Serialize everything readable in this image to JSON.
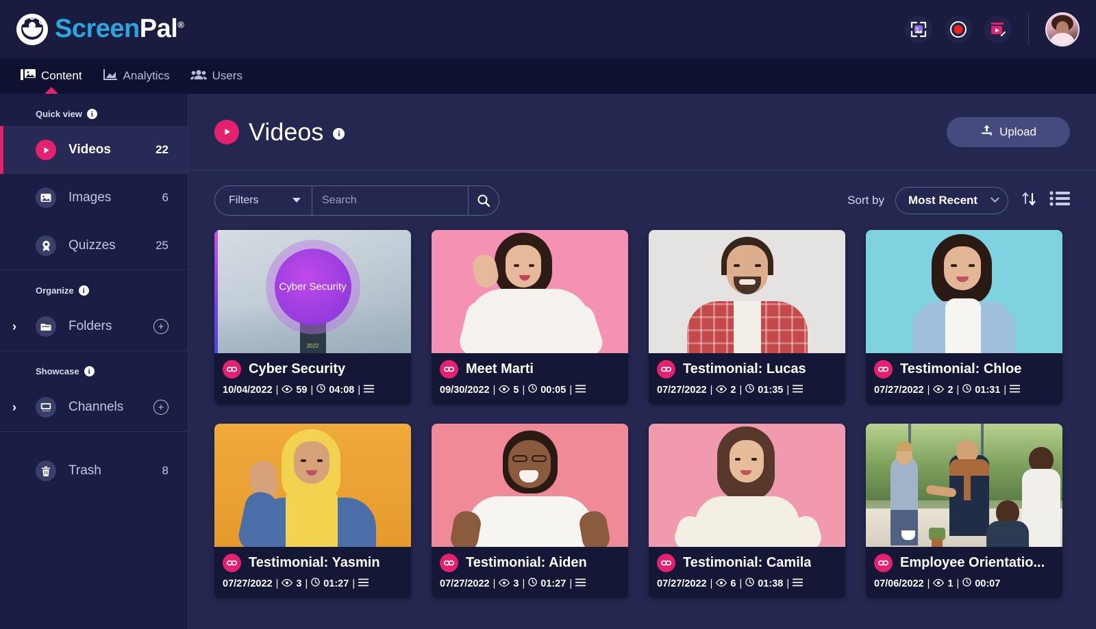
{
  "brand": {
    "name_part1": "Screen",
    "name_part2": "Pal",
    "registered": "®"
  },
  "topbar": {
    "actions": [
      {
        "name": "screenshot-icon",
        "label": "Screenshot"
      },
      {
        "name": "record-icon",
        "label": "Record"
      },
      {
        "name": "video-editor-icon",
        "label": "Video Editor"
      }
    ],
    "avatar_label": "Account"
  },
  "nav": {
    "items": [
      {
        "label": "Content",
        "icon": "content-icon",
        "active": true
      },
      {
        "label": "Analytics",
        "icon": "analytics-icon",
        "active": false
      },
      {
        "label": "Users",
        "icon": "users-icon",
        "active": false
      }
    ]
  },
  "sidebar": {
    "quick_view_label": "Quick view",
    "organize_label": "Organize",
    "showcase_label": "Showcase",
    "info_glyph": "i",
    "items": [
      {
        "label": "Videos",
        "count": "22",
        "icon": "video-play-icon",
        "active": true
      },
      {
        "label": "Images",
        "count": "6",
        "icon": "image-icon",
        "active": false
      },
      {
        "label": "Quizzes",
        "count": "25",
        "icon": "quiz-ribbon-icon",
        "active": false
      }
    ],
    "folders": {
      "label": "Folders",
      "icon": "folder-icon",
      "add_label": "+",
      "chevron": "›"
    },
    "channels": {
      "label": "Channels",
      "icon": "channel-screen-icon",
      "add_label": "+",
      "chevron": "›"
    },
    "trash": {
      "label": "Trash",
      "count": "8",
      "icon": "trash-icon"
    }
  },
  "page": {
    "title": "Videos",
    "info_glyph": "i",
    "upload_label": "Upload"
  },
  "toolbar": {
    "filters_label": "Filters",
    "search_placeholder": "Search",
    "search_value": "",
    "search_button_name": "search-icon",
    "sort_by_label": "Sort by",
    "sort_value": "Most Recent",
    "sort_direction_name": "sort-direction-icon",
    "list_view_name": "list-view-icon"
  },
  "colors": {
    "accent_pink": "#e5206e",
    "brand_blue": "#2ba7e0",
    "topbar_bg": "#191c3f",
    "navbar_bg": "#0f1130",
    "sidebar_bg": "#1b1e44",
    "main_bg": "#242851",
    "card_bg": "#141735"
  },
  "videos": [
    {
      "title": "Cyber Security",
      "date": "10/04/2022",
      "views": "59",
      "duration": "04:08",
      "thumb_class": "t-cyber",
      "thumb_text": "Cyber Security",
      "thumb_year": "2022",
      "has_menu": true
    },
    {
      "title": "Meet Marti",
      "date": "09/30/2022",
      "views": "5",
      "duration": "00:05",
      "thumb_class": "t-marti",
      "has_menu": true
    },
    {
      "title": "Testimonial: Lucas",
      "date": "07/27/2022",
      "views": "2",
      "duration": "01:35",
      "thumb_class": "t-lucas",
      "has_menu": true
    },
    {
      "title": "Testimonial: Chloe",
      "date": "07/27/2022",
      "views": "2",
      "duration": "01:31",
      "thumb_class": "t-chloe",
      "has_menu": true
    },
    {
      "title": "Testimonial: Yasmin",
      "date": "07/27/2022",
      "views": "3",
      "duration": "01:27",
      "thumb_class": "t-yasmin",
      "has_menu": true
    },
    {
      "title": "Testimonial: Aiden",
      "date": "07/27/2022",
      "views": "3",
      "duration": "01:27",
      "thumb_class": "t-aiden",
      "has_menu": true
    },
    {
      "title": "Testimonial: Camila",
      "date": "07/27/2022",
      "views": "6",
      "duration": "01:38",
      "thumb_class": "t-camila",
      "has_menu": true
    },
    {
      "title": "Employee Orientatio...",
      "date": "07/06/2022",
      "views": "1",
      "duration": "00:07",
      "thumb_class": "t-office",
      "has_menu": false
    }
  ],
  "glyphs": {
    "eye": "◉",
    "clock": "◷",
    "menu": "≡",
    "pipe": "|"
  }
}
